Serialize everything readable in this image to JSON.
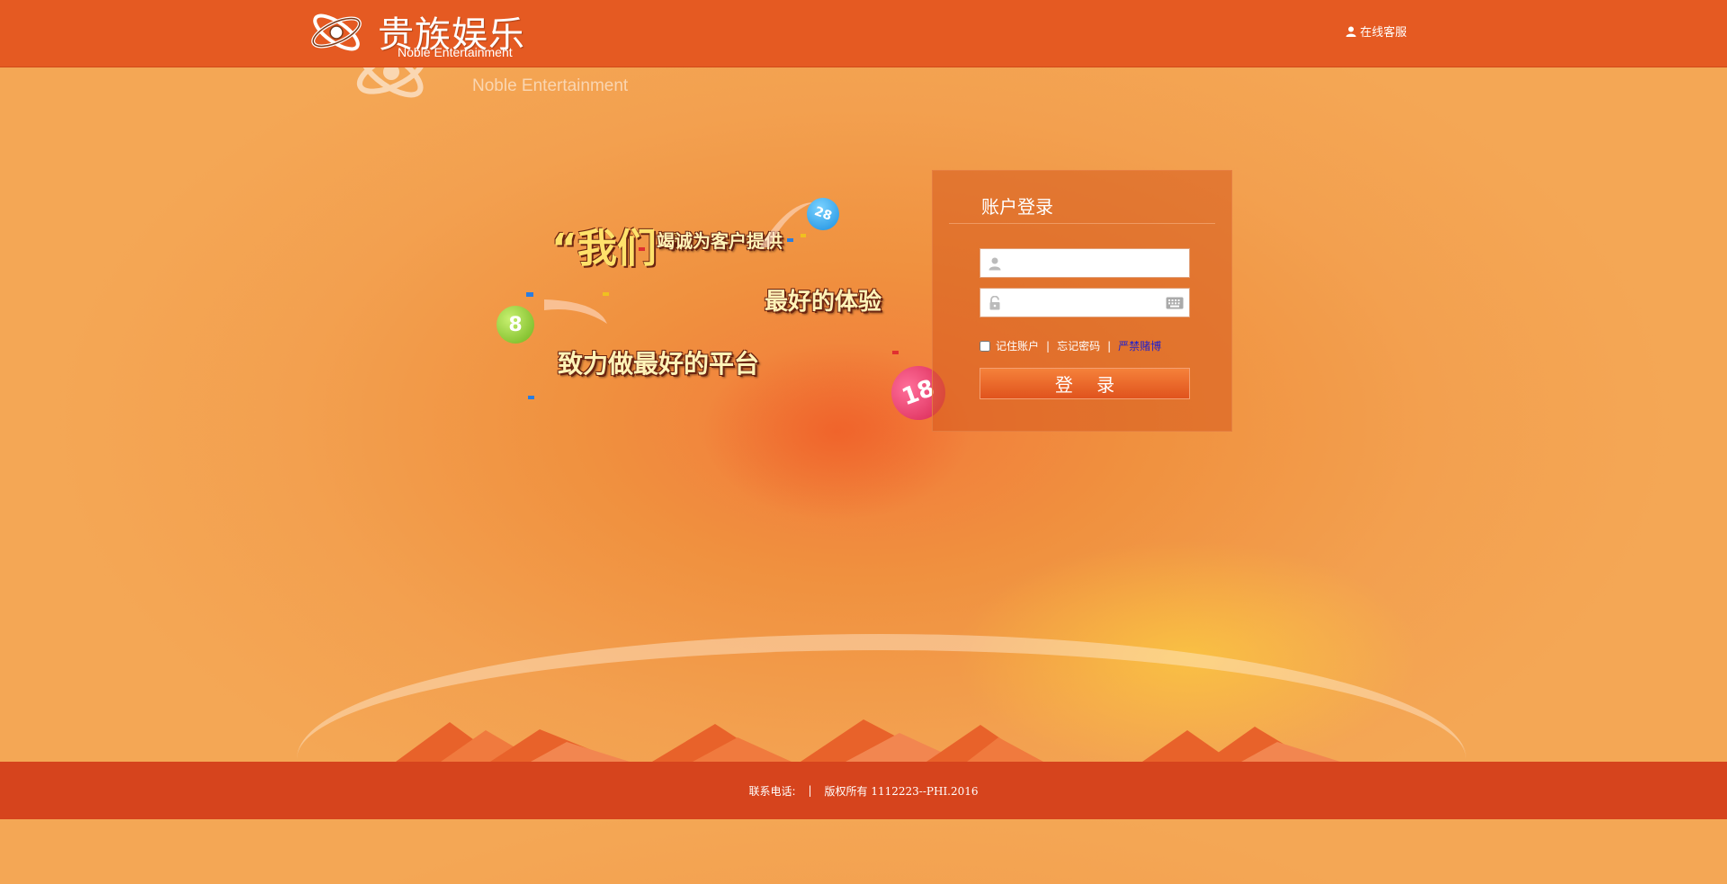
{
  "header": {
    "brand_cn": "贵族娱乐",
    "brand_en": "Noble Entertainment",
    "support_label": "在线客服",
    "bg_color": "#e55a22"
  },
  "background_logo": {
    "brand_en": "Noble Entertainment"
  },
  "slogan": {
    "quote": "“我们”",
    "line1": "竭诚为客户提供",
    "line2": "最好的体验",
    "line3": "致力做最好的平台"
  },
  "balls": {
    "blue": "28",
    "green": "8",
    "pink": "18"
  },
  "login": {
    "title": "账户登录",
    "username_placeholder": "",
    "password_placeholder": "",
    "remember_label": "记住账户",
    "forgot_label": "忘记密码",
    "ban_label": "严禁赌博",
    "submit_label": "登 录",
    "separator": "|"
  },
  "footer": {
    "contact_label": "联系电话:",
    "separator": "|",
    "copyright": "版权所有 1112223--PHI.2016",
    "bg_color": "#d6441d"
  },
  "icons": {
    "logo": "noble-logo-icon",
    "support": "user-icon",
    "username": "user-icon",
    "password": "lock-icon",
    "keyboard": "keyboard-icon"
  }
}
